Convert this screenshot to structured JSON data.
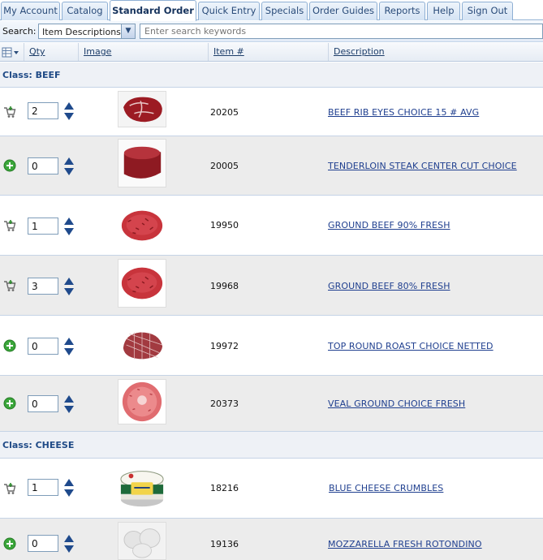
{
  "tabs": [
    {
      "label": "My Account",
      "active": false
    },
    {
      "label": "Catalog",
      "active": false
    },
    {
      "label": "Standard Order",
      "active": true
    },
    {
      "label": "Quick Entry",
      "active": false
    },
    {
      "label": "Specials",
      "active": false
    },
    {
      "label": "Order Guides",
      "active": false
    },
    {
      "label": "Reports",
      "active": false
    },
    {
      "label": "Help",
      "active": false
    },
    {
      "label": "Sign Out",
      "active": false
    }
  ],
  "search": {
    "label": "Search:",
    "scope_selected": "Item Descriptions",
    "placeholder": "Enter search keywords",
    "value": ""
  },
  "columns": {
    "qty": "Qty",
    "image": "Image",
    "item_number": "Item #",
    "description": "Description"
  },
  "classes": [
    {
      "title": "Class: BEEF",
      "items": [
        {
          "qty": "2",
          "in_cart": true,
          "item_number": "20205",
          "description": "BEEF RIB EYES CHOICE 15 # AVG",
          "image": "ribeye-steak"
        },
        {
          "qty": "0",
          "in_cart": false,
          "item_number": "20005",
          "description": "TENDERLOIN STEAK CENTER CUT CHOICE",
          "image": "tenderloin-steak"
        },
        {
          "qty": "1",
          "in_cart": true,
          "item_number": "19950",
          "description": "GROUND BEEF 90% FRESH",
          "image": "ground-beef"
        },
        {
          "qty": "3",
          "in_cart": true,
          "item_number": "19968",
          "description": "GROUND BEEF 80% FRESH",
          "image": "ground-beef"
        },
        {
          "qty": "0",
          "in_cart": false,
          "item_number": "19972",
          "description": "TOP ROUND ROAST CHOICE NETTED",
          "image": "netted-roast"
        },
        {
          "qty": "0",
          "in_cart": false,
          "item_number": "20373",
          "description": "VEAL GROUND CHOICE FRESH",
          "image": "ground-veal"
        }
      ]
    },
    {
      "title": "Class: CHEESE",
      "items": [
        {
          "qty": "1",
          "in_cart": true,
          "item_number": "18216",
          "description": "BLUE CHEESE CRUMBLES",
          "image": "blue-cheese-tub"
        },
        {
          "qty": "0",
          "in_cart": false,
          "item_number": "19136",
          "description": "MOZZARELLA FRESH ROTONDINO",
          "image": "mozzarella-balls"
        }
      ]
    }
  ],
  "colors": {
    "tab_text": "#2a4c7a",
    "class_header_text": "#1f4a86",
    "link": "#1f3f8f",
    "row_shade": "#ececec",
    "add_icon": "#3aa63a"
  },
  "icons": {
    "column_chooser": "grid-menu-icon",
    "in_cart": "shopping-cart-icon",
    "add": "add-plus-icon",
    "qty_stepper": "up-down-arrows-icon",
    "dropdown": "chevron-down-icon"
  }
}
